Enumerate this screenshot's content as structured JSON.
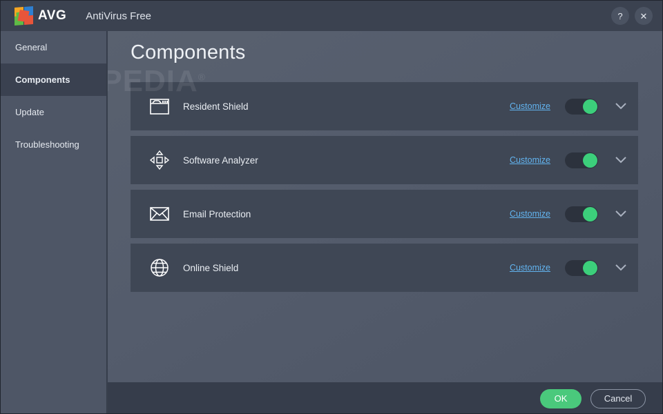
{
  "window": {
    "brand_wordmark": "AVG",
    "product_name": "AntiVirus Free",
    "help_button_label": "?",
    "close_button_label": "✕"
  },
  "sidebar": {
    "items": [
      {
        "label": "General",
        "active": false
      },
      {
        "label": "Components",
        "active": true
      },
      {
        "label": "Update",
        "active": false
      },
      {
        "label": "Troubleshooting",
        "active": false
      }
    ]
  },
  "main": {
    "page_title": "Components",
    "watermark": "SOFTPEDIA",
    "watermark_mark": "®",
    "components": [
      {
        "icon": "window-icon",
        "label": "Resident Shield",
        "customize_label": "Customize",
        "enabled": true,
        "expand_icon": "chevron-down-icon"
      },
      {
        "icon": "move-arrows-icon",
        "label": "Software Analyzer",
        "customize_label": "Customize",
        "enabled": true,
        "expand_icon": "chevron-down-icon"
      },
      {
        "icon": "envelope-icon",
        "label": "Email Protection",
        "customize_label": "Customize",
        "enabled": true,
        "expand_icon": "chevron-down-icon"
      },
      {
        "icon": "globe-icon",
        "label": "Online Shield",
        "customize_label": "Customize",
        "enabled": true,
        "expand_icon": "chevron-down-icon"
      }
    ]
  },
  "footer": {
    "ok_label": "OK",
    "cancel_label": "Cancel"
  },
  "colors": {
    "accent_green": "#3ccf7b",
    "link_blue": "#62b4f0",
    "titlebar_bg": "#3b4250",
    "sidebar_bg": "#4e5666",
    "sidebar_active_bg": "#3a4150",
    "row_bg": "#3f4755",
    "footer_bg": "#363d4b"
  }
}
